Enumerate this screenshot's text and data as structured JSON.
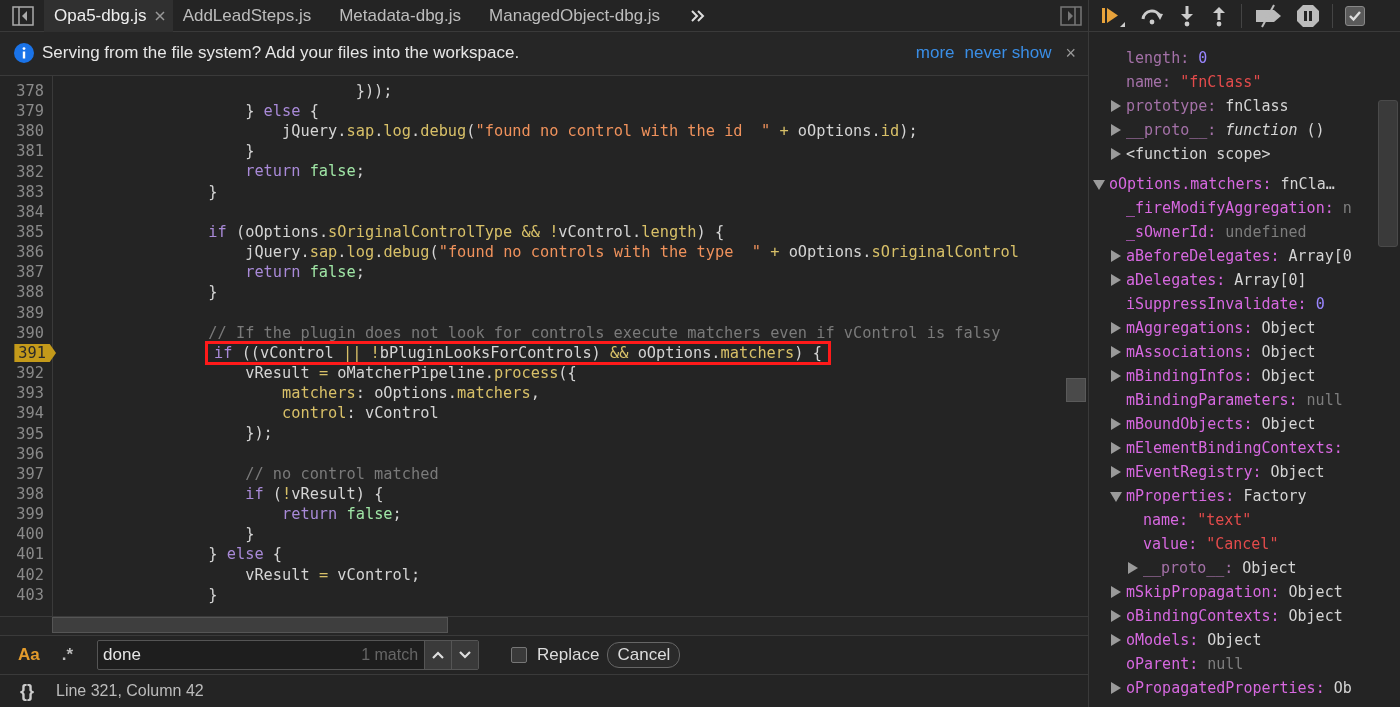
{
  "editor_tabs": [
    {
      "label": "Opa5-dbg.js",
      "selected": true,
      "closable": true
    },
    {
      "label": "AddLeadSteps.js",
      "selected": false
    },
    {
      "label": "Metadata-dbg.js",
      "selected": false
    },
    {
      "label": "ManagedObject-dbg.js",
      "selected": false
    }
  ],
  "infobar": {
    "message": "Serving from the file system? Add your files into the workspace.",
    "links": [
      "more",
      "never show"
    ],
    "close": "×"
  },
  "code_lines": [
    {
      "num": "378",
      "tokens": [
        {
          "text": "                                }));",
          "kind": "plain"
        }
      ]
    },
    {
      "num": "379",
      "tokens": [
        {
          "text": "                    } ",
          "kind": "plain"
        },
        {
          "text": "else",
          "kind": "keyword"
        },
        {
          "text": " {",
          "kind": "plain"
        }
      ]
    },
    {
      "num": "380",
      "tokens": [
        {
          "text": "                        jQuery.",
          "kind": "plain"
        },
        {
          "text": "sap",
          "kind": "property"
        },
        {
          "text": ".",
          "kind": "plain"
        },
        {
          "text": "log",
          "kind": "property"
        },
        {
          "text": ".",
          "kind": "plain"
        },
        {
          "text": "debug",
          "kind": "property"
        },
        {
          "text": "(",
          "kind": "plain"
        },
        {
          "text": "\"found no control with the id  \"",
          "kind": "string"
        },
        {
          "text": " +",
          "kind": "operator"
        },
        {
          "text": " oOptions.",
          "kind": "plain"
        },
        {
          "text": "id",
          "kind": "property"
        },
        {
          "text": ");",
          "kind": "plain"
        }
      ]
    },
    {
      "num": "381",
      "tokens": [
        {
          "text": "                    }",
          "kind": "plain"
        }
      ]
    },
    {
      "num": "382",
      "tokens": [
        {
          "text": "                    return",
          "kind": "keyword"
        },
        {
          "text": " false",
          "kind": "literal"
        },
        {
          "text": ";",
          "kind": "plain"
        }
      ]
    },
    {
      "num": "383",
      "tokens": [
        {
          "text": "                }",
          "kind": "plain"
        }
      ]
    },
    {
      "num": "384"
    },
    {
      "num": "385",
      "tokens": [
        {
          "text": "                if",
          "kind": "keyword"
        },
        {
          "text": " (oOptions.",
          "kind": "plain"
        },
        {
          "text": "sOriginalControlType",
          "kind": "property"
        },
        {
          "text": " && !",
          "kind": "operator"
        },
        {
          "text": "vControl.",
          "kind": "plain"
        },
        {
          "text": "length",
          "kind": "property"
        },
        {
          "text": ") {",
          "kind": "plain"
        }
      ]
    },
    {
      "num": "386",
      "tokens": [
        {
          "text": "                    jQuery.",
          "kind": "plain"
        },
        {
          "text": "sap",
          "kind": "property"
        },
        {
          "text": ".",
          "kind": "plain"
        },
        {
          "text": "log",
          "kind": "property"
        },
        {
          "text": ".",
          "kind": "plain"
        },
        {
          "text": "debug",
          "kind": "property"
        },
        {
          "text": "(",
          "kind": "plain"
        },
        {
          "text": "\"found no controls with the type  \"",
          "kind": "string"
        },
        {
          "text": " +",
          "kind": "operator"
        },
        {
          "text": " oOptions.",
          "kind": "plain"
        },
        {
          "text": "sOriginalControl",
          "kind": "property"
        }
      ]
    },
    {
      "num": "387",
      "tokens": [
        {
          "text": "                    return",
          "kind": "keyword"
        },
        {
          "text": " false",
          "kind": "literal"
        },
        {
          "text": ";",
          "kind": "plain"
        }
      ]
    },
    {
      "num": "388",
      "tokens": [
        {
          "text": "                }",
          "kind": "plain"
        }
      ]
    },
    {
      "num": "389"
    },
    {
      "num": "390",
      "tokens": [
        {
          "text": "                // If the plugin does not look for controls execute matchers even if vControl is falsy",
          "kind": "comment"
        }
      ]
    },
    {
      "num": "391",
      "breakpoint": true,
      "boxed": true,
      "tokens": [
        {
          "text": "if",
          "kind": "keyword"
        },
        {
          "text": " ((vControl ",
          "kind": "plain"
        },
        {
          "text": "|| !",
          "kind": "operator"
        },
        {
          "text": "bPluginLooksForControls) ",
          "kind": "plain"
        },
        {
          "text": "&&",
          "kind": "operator"
        },
        {
          "text": " oOptions.",
          "kind": "plain"
        },
        {
          "text": "matchers",
          "kind": "property"
        },
        {
          "text": ") {",
          "kind": "plain"
        }
      ]
    },
    {
      "num": "392",
      "tokens": [
        {
          "text": "                    vResult ",
          "kind": "plain"
        },
        {
          "text": "=",
          "kind": "operator"
        },
        {
          "text": " oMatcherPipeline.",
          "kind": "plain"
        },
        {
          "text": "process",
          "kind": "property"
        },
        {
          "text": "({",
          "kind": "plain"
        }
      ]
    },
    {
      "num": "393",
      "tokens": [
        {
          "text": "                        matchers",
          "kind": "property"
        },
        {
          "text": ": oOptions.",
          "kind": "plain"
        },
        {
          "text": "matchers",
          "kind": "property"
        },
        {
          "text": ",",
          "kind": "plain"
        }
      ]
    },
    {
      "num": "394",
      "tokens": [
        {
          "text": "                        control",
          "kind": "property"
        },
        {
          "text": ": vControl",
          "kind": "plain"
        }
      ]
    },
    {
      "num": "395",
      "tokens": [
        {
          "text": "                    });",
          "kind": "plain"
        }
      ]
    },
    {
      "num": "396"
    },
    {
      "num": "397",
      "tokens": [
        {
          "text": "                    // no control matched",
          "kind": "comment"
        }
      ]
    },
    {
      "num": "398",
      "tokens": [
        {
          "text": "                    if",
          "kind": "keyword"
        },
        {
          "text": " (",
          "kind": "plain"
        },
        {
          "text": "!",
          "kind": "operator"
        },
        {
          "text": "vResult) {",
          "kind": "plain"
        }
      ]
    },
    {
      "num": "399",
      "tokens": [
        {
          "text": "                        return",
          "kind": "keyword"
        },
        {
          "text": " false",
          "kind": "literal"
        },
        {
          "text": ";",
          "kind": "plain"
        }
      ]
    },
    {
      "num": "400",
      "tokens": [
        {
          "text": "                    }",
          "kind": "plain"
        }
      ]
    },
    {
      "num": "401",
      "tokens": [
        {
          "text": "                } ",
          "kind": "plain"
        },
        {
          "text": "else",
          "kind": "keyword"
        },
        {
          "text": " {",
          "kind": "plain"
        }
      ]
    },
    {
      "num": "402",
      "tokens": [
        {
          "text": "                    vResult ",
          "kind": "plain"
        },
        {
          "text": "=",
          "kind": "operator"
        },
        {
          "text": " vControl;",
          "kind": "plain"
        }
      ]
    },
    {
      "num": "403",
      "tokens": [
        {
          "text": "                }",
          "kind": "plain"
        }
      ]
    }
  ],
  "search_bar": {
    "match_case_label": "Aa",
    "match_case": true,
    "regex_label": ".*",
    "regex": false,
    "query": "done",
    "match_count": "1 match",
    "replace_label": "Replace",
    "replace": false,
    "cancel": "Cancel"
  },
  "status_bar": {
    "format_label": "{}",
    "position": "Line 321, Column 42"
  },
  "debugger_toolbar": {
    "checkbox_checked": true
  },
  "scope": {
    "clipped_group": [
      {
        "kind": "property",
        "key": "length:",
        "value": {
          "text": "0",
          "kind": "number"
        },
        "dim": true
      },
      {
        "kind": "property",
        "key": "name:",
        "value": {
          "text": "\"fnClass\"",
          "kind": "string"
        },
        "dim": true
      },
      {
        "kind": "property",
        "key": "prototype:",
        "value": {
          "text": "fnClass",
          "kind": "object"
        },
        "dim": true,
        "expanded": false
      },
      {
        "kind": "property",
        "key": "__proto__:",
        "value": {
          "text": "*function* ()",
          "kind": "function"
        },
        "dim": true,
        "expanded": false
      },
      {
        "kind": "scope",
        "key": "<function scope>",
        "expanded": false
      }
    ],
    "objects": [
      {
        "kind": "property",
        "key": "oOptions.matchers:",
        "value": {
          "text": "fnCla…",
          "kind": "object"
        },
        "dim": false,
        "expanded": true,
        "children": [
          {
            "kind": "property",
            "key": "_fireModifyAggregation:",
            "value": {
              "text": "n",
              "kind": "null"
            },
            "dim": false
          },
          {
            "kind": "property",
            "key": "_sOwnerId:",
            "value": {
              "text": "undefined",
              "kind": "null"
            },
            "dim": false
          },
          {
            "kind": "property",
            "key": "aBeforeDelegates:",
            "value": {
              "text": "Array[0",
              "kind": "object"
            },
            "dim": false,
            "expanded": false
          },
          {
            "kind": "property",
            "key": "aDelegates:",
            "value": {
              "text": "Array[0]",
              "kind": "object"
            },
            "dim": false,
            "expanded": false
          },
          {
            "kind": "property",
            "key": "iSuppressInvalidate:",
            "value": {
              "text": "0",
              "kind": "number"
            },
            "dim": false
          },
          {
            "kind": "property",
            "key": "mAggregations:",
            "value": {
              "text": "Object",
              "kind": "object"
            },
            "dim": false,
            "expanded": false
          },
          {
            "kind": "property",
            "key": "mAssociations:",
            "value": {
              "text": "Object",
              "kind": "object"
            },
            "dim": false,
            "expanded": false
          },
          {
            "kind": "property",
            "key": "mBindingInfos:",
            "value": {
              "text": "Object",
              "kind": "object"
            },
            "dim": false,
            "expanded": false
          },
          {
            "kind": "property",
            "key": "mBindingParameters:",
            "value": {
              "text": "null",
              "kind": "null"
            },
            "dim": false
          },
          {
            "kind": "property",
            "key": "mBoundObjects:",
            "value": {
              "text": "Object",
              "kind": "object"
            },
            "dim": false,
            "expanded": false
          },
          {
            "kind": "property",
            "key": "mElementBindingContexts:",
            "dim": false,
            "expanded": false
          },
          {
            "kind": "property",
            "key": "mEventRegistry:",
            "value": {
              "text": "Object",
              "kind": "object"
            },
            "dim": false,
            "expanded": false
          },
          {
            "kind": "property",
            "key": "mProperties:",
            "value": {
              "text": "Factory",
              "kind": "object"
            },
            "dim": false,
            "expanded": true,
            "children": [
              {
                "kind": "property",
                "key": "name:",
                "value": {
                  "text": "\"text\"",
                  "kind": "string"
                },
                "dim": false
              },
              {
                "kind": "property",
                "key": "value:",
                "value": {
                  "text": "\"Cancel\"",
                  "kind": "string"
                },
                "dim": false
              },
              {
                "kind": "property",
                "key": "__proto__:",
                "value": {
                  "text": "Object",
                  "kind": "object"
                },
                "dim": true,
                "expanded": false
              }
            ]
          },
          {
            "kind": "property",
            "key": "mSkipPropagation:",
            "value": {
              "text": "Object",
              "kind": "object"
            },
            "dim": false,
            "expanded": false
          },
          {
            "kind": "property",
            "key": "oBindingContexts:",
            "value": {
              "text": "Object",
              "kind": "object"
            },
            "dim": false,
            "expanded": false
          },
          {
            "kind": "property",
            "key": "oModels:",
            "value": {
              "text": "Object",
              "kind": "object"
            },
            "dim": false,
            "expanded": false
          },
          {
            "kind": "property",
            "key": "oParent:",
            "value": {
              "text": "null",
              "kind": "null"
            },
            "dim": false
          },
          {
            "kind": "property",
            "key": "oPropagatedProperties:",
            "value": {
              "text": "Ob",
              "kind": "object"
            },
            "dim": false,
            "expanded": false
          }
        ]
      }
    ]
  }
}
